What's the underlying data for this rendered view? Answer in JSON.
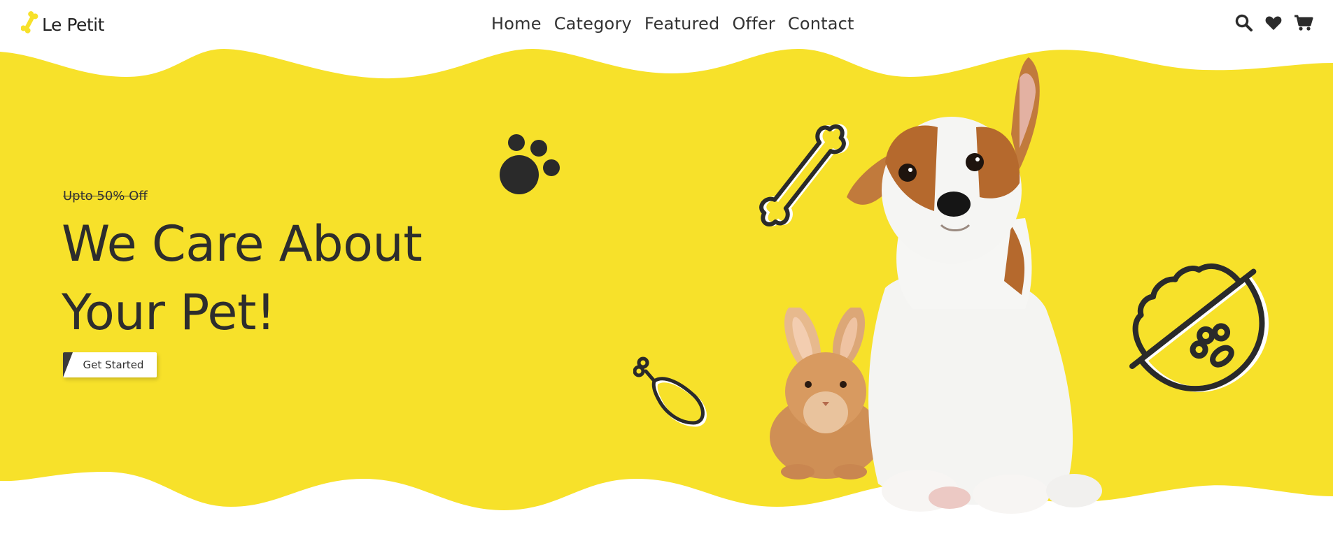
{
  "brand": {
    "name": "Le Petit",
    "logo_icon": "bone-icon",
    "accent": "#F7E12A"
  },
  "nav": {
    "items": [
      {
        "label": "Home"
      },
      {
        "label": "Category"
      },
      {
        "label": "Featured"
      },
      {
        "label": "Offer"
      },
      {
        "label": "Contact"
      }
    ]
  },
  "header_icons": [
    "search-icon",
    "heart-icon",
    "cart-icon"
  ],
  "hero": {
    "offer_text": "Upto 50% Off",
    "headline_line1": "We Care About",
    "headline_line2": "Your Pet!",
    "cta_label": "Get Started",
    "background_color": "#F7E12A",
    "text_color": "#2D2D2D"
  },
  "decorations": [
    "paw-print-icon",
    "bone-outline-icon",
    "drumstick-outline-icon",
    "food-bowl-outline-icon",
    "puppy-image",
    "rabbit-image"
  ]
}
